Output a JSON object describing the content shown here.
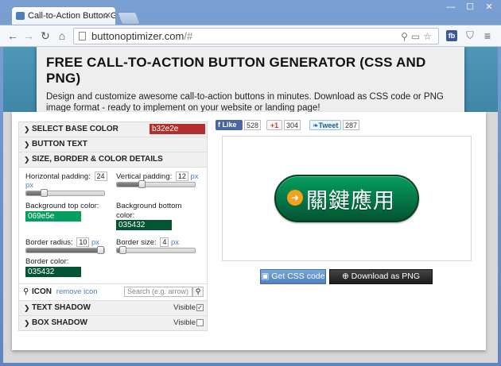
{
  "browser": {
    "tab_title": "Call-to-Action Button Ge",
    "tab_close": "✕",
    "url_host": "buttonoptimizer.com",
    "url_path": "/#",
    "ext_fb": "fb",
    "win_minimize": "—",
    "win_maximize": "☐",
    "win_close": "✕"
  },
  "banner": {
    "title": "FREE CALL-TO-ACTION BUTTON GENERATOR (CSS AND PNG)",
    "description": "Design and customize awesome call-to-action buttons in minutes. Download as CSS code or PNG image format - ready to implement on your website or landing page!"
  },
  "panel": {
    "select_base_color": "SELECT BASE COLOR",
    "base_color_value": "b32e2e",
    "button_text": "BUTTON TEXT",
    "size_section": "SIZE, BORDER & COLOR DETAILS",
    "h_padding_label": "Horizontal padding:",
    "h_padding_value": "24",
    "h_padding_level": 0.2,
    "v_padding_label": "Vertical padding:",
    "v_padding_value": "12",
    "v_padding_level": 0.3,
    "unit_px": "px",
    "bg_top_label": "Background top color:",
    "bg_top_value": "069e5e",
    "bg_bottom_label_1": "Background bottom",
    "bg_bottom_label_2": "color:",
    "bg_bottom_value": "035432",
    "border_radius_label": "Border radius:",
    "border_radius_value": "10",
    "border_radius_level": 1.0,
    "border_size_label": "Border size:",
    "border_size_value": "4",
    "border_size_level": 0.03,
    "border_color_label": "Border color:",
    "border_color_value": "035432",
    "icon_label": "ICON",
    "remove_icon": "remove icon",
    "icon_search_placeholder": "Search (e.g. arrow)",
    "text_shadow": "TEXT SHADOW",
    "box_shadow": "BOX SHADOW",
    "visible": "Visible"
  },
  "social": {
    "like": "Like",
    "like_count": "528",
    "gplus": "+1",
    "gplus_count": "304",
    "tweet": "Tweet",
    "tweet_count": "287"
  },
  "preview": {
    "button_text": "關鍵應用",
    "icon": "arrow-icon"
  },
  "actions": {
    "get_css": "Get CSS code",
    "download_png": "Download as PNG image"
  },
  "colors": {
    "base": "#b32e2e",
    "bg_top": "#069e5e",
    "bg_bottom": "#035432",
    "border": "#035432"
  }
}
